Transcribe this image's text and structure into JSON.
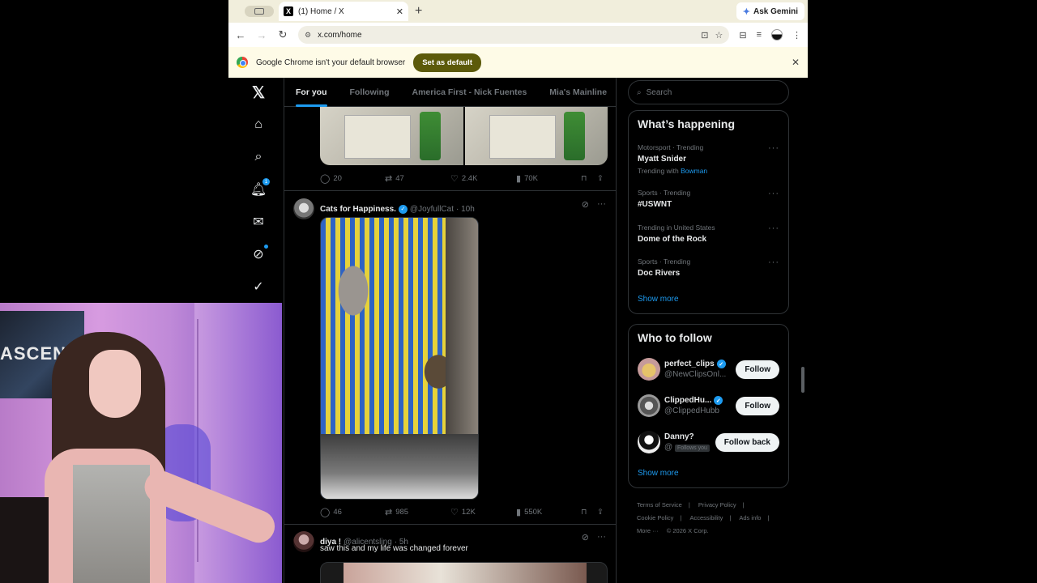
{
  "browser": {
    "tab_title": "(1) Home / X",
    "gemini_label": "Ask Gemini",
    "url": "x.com/home",
    "infobar_text": "Google Chrome isn't your default browser",
    "set_default_label": "Set as default"
  },
  "nav": {
    "notifications_badge": "1"
  },
  "feed": {
    "tabs": [
      "For you",
      "Following",
      "America First - Nick Fuentes",
      "Mia's Mainline"
    ],
    "post1_stats": {
      "replies": "20",
      "reposts": "47",
      "likes": "2.4K",
      "views": "70K"
    },
    "post2": {
      "name": "Cats for Happiness.",
      "handle": "@JoyfullCat",
      "time": "· 10h",
      "stats": {
        "replies": "46",
        "reposts": "985",
        "likes": "12K",
        "views": "550K"
      }
    },
    "post3": {
      "name": "diya !",
      "handle": "@alicentsling",
      "time": "· 5h",
      "text": "saw this and my life was changed forever"
    }
  },
  "sidebar": {
    "search_placeholder": "Search",
    "happening_title": "What’s happening",
    "trends": [
      {
        "meta": "Motorsport · Trending",
        "title": "Myatt Snider",
        "with_prefix": "Trending with",
        "with_link": "Bowman"
      },
      {
        "meta": "Sports · Trending",
        "title": "#USWNT"
      },
      {
        "meta": "Trending in United States",
        "title": "Dome of the Rock"
      },
      {
        "meta": "Sports · Trending",
        "title": "Doc Rivers"
      }
    ],
    "show_more": "Show more",
    "follow_title": "Who to follow",
    "follow": [
      {
        "name": "perfect_clips",
        "handle": "@NewClipsOnl...",
        "button": "Follow"
      },
      {
        "name": "ClippedHu...",
        "handle": "@ClippedHubb",
        "button": "Follow"
      },
      {
        "name": "Danny?",
        "handle": "@",
        "follows_you": "Follows you",
        "button": "Follow back"
      }
    ],
    "footer": {
      "tos": "Terms of Service",
      "privacy": "Privacy Policy",
      "cookie": "Cookie Policy",
      "access": "Accessibility",
      "ads": "Ads info",
      "more": "More ···",
      "copyright": "© 2026 X Corp."
    }
  },
  "colors": {
    "accent": "#1d9bf0",
    "default_button": "#5c5a0a"
  }
}
